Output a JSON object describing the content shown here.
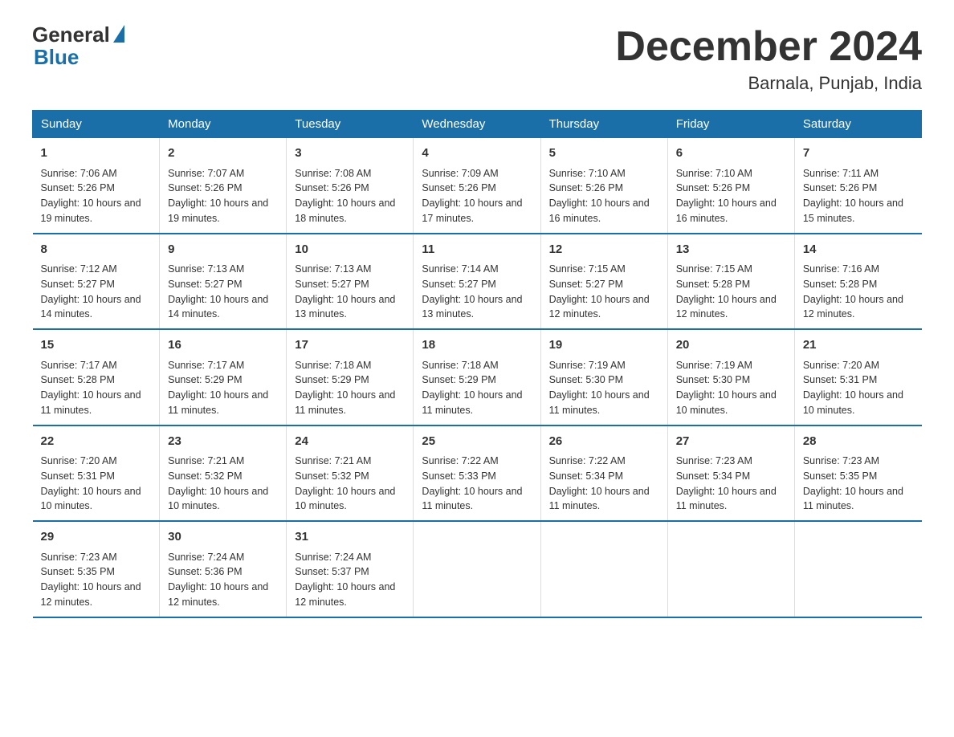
{
  "header": {
    "logo_general": "General",
    "logo_blue": "Blue",
    "month_title": "December 2024",
    "location": "Barnala, Punjab, India"
  },
  "days_of_week": [
    "Sunday",
    "Monday",
    "Tuesday",
    "Wednesday",
    "Thursday",
    "Friday",
    "Saturday"
  ],
  "weeks": [
    [
      {
        "day": "1",
        "sunrise": "Sunrise: 7:06 AM",
        "sunset": "Sunset: 5:26 PM",
        "daylight": "Daylight: 10 hours and 19 minutes."
      },
      {
        "day": "2",
        "sunrise": "Sunrise: 7:07 AM",
        "sunset": "Sunset: 5:26 PM",
        "daylight": "Daylight: 10 hours and 19 minutes."
      },
      {
        "day": "3",
        "sunrise": "Sunrise: 7:08 AM",
        "sunset": "Sunset: 5:26 PM",
        "daylight": "Daylight: 10 hours and 18 minutes."
      },
      {
        "day": "4",
        "sunrise": "Sunrise: 7:09 AM",
        "sunset": "Sunset: 5:26 PM",
        "daylight": "Daylight: 10 hours and 17 minutes."
      },
      {
        "day": "5",
        "sunrise": "Sunrise: 7:10 AM",
        "sunset": "Sunset: 5:26 PM",
        "daylight": "Daylight: 10 hours and 16 minutes."
      },
      {
        "day": "6",
        "sunrise": "Sunrise: 7:10 AM",
        "sunset": "Sunset: 5:26 PM",
        "daylight": "Daylight: 10 hours and 16 minutes."
      },
      {
        "day": "7",
        "sunrise": "Sunrise: 7:11 AM",
        "sunset": "Sunset: 5:26 PM",
        "daylight": "Daylight: 10 hours and 15 minutes."
      }
    ],
    [
      {
        "day": "8",
        "sunrise": "Sunrise: 7:12 AM",
        "sunset": "Sunset: 5:27 PM",
        "daylight": "Daylight: 10 hours and 14 minutes."
      },
      {
        "day": "9",
        "sunrise": "Sunrise: 7:13 AM",
        "sunset": "Sunset: 5:27 PM",
        "daylight": "Daylight: 10 hours and 14 minutes."
      },
      {
        "day": "10",
        "sunrise": "Sunrise: 7:13 AM",
        "sunset": "Sunset: 5:27 PM",
        "daylight": "Daylight: 10 hours and 13 minutes."
      },
      {
        "day": "11",
        "sunrise": "Sunrise: 7:14 AM",
        "sunset": "Sunset: 5:27 PM",
        "daylight": "Daylight: 10 hours and 13 minutes."
      },
      {
        "day": "12",
        "sunrise": "Sunrise: 7:15 AM",
        "sunset": "Sunset: 5:27 PM",
        "daylight": "Daylight: 10 hours and 12 minutes."
      },
      {
        "day": "13",
        "sunrise": "Sunrise: 7:15 AM",
        "sunset": "Sunset: 5:28 PM",
        "daylight": "Daylight: 10 hours and 12 minutes."
      },
      {
        "day": "14",
        "sunrise": "Sunrise: 7:16 AM",
        "sunset": "Sunset: 5:28 PM",
        "daylight": "Daylight: 10 hours and 12 minutes."
      }
    ],
    [
      {
        "day": "15",
        "sunrise": "Sunrise: 7:17 AM",
        "sunset": "Sunset: 5:28 PM",
        "daylight": "Daylight: 10 hours and 11 minutes."
      },
      {
        "day": "16",
        "sunrise": "Sunrise: 7:17 AM",
        "sunset": "Sunset: 5:29 PM",
        "daylight": "Daylight: 10 hours and 11 minutes."
      },
      {
        "day": "17",
        "sunrise": "Sunrise: 7:18 AM",
        "sunset": "Sunset: 5:29 PM",
        "daylight": "Daylight: 10 hours and 11 minutes."
      },
      {
        "day": "18",
        "sunrise": "Sunrise: 7:18 AM",
        "sunset": "Sunset: 5:29 PM",
        "daylight": "Daylight: 10 hours and 11 minutes."
      },
      {
        "day": "19",
        "sunrise": "Sunrise: 7:19 AM",
        "sunset": "Sunset: 5:30 PM",
        "daylight": "Daylight: 10 hours and 11 minutes."
      },
      {
        "day": "20",
        "sunrise": "Sunrise: 7:19 AM",
        "sunset": "Sunset: 5:30 PM",
        "daylight": "Daylight: 10 hours and 10 minutes."
      },
      {
        "day": "21",
        "sunrise": "Sunrise: 7:20 AM",
        "sunset": "Sunset: 5:31 PM",
        "daylight": "Daylight: 10 hours and 10 minutes."
      }
    ],
    [
      {
        "day": "22",
        "sunrise": "Sunrise: 7:20 AM",
        "sunset": "Sunset: 5:31 PM",
        "daylight": "Daylight: 10 hours and 10 minutes."
      },
      {
        "day": "23",
        "sunrise": "Sunrise: 7:21 AM",
        "sunset": "Sunset: 5:32 PM",
        "daylight": "Daylight: 10 hours and 10 minutes."
      },
      {
        "day": "24",
        "sunrise": "Sunrise: 7:21 AM",
        "sunset": "Sunset: 5:32 PM",
        "daylight": "Daylight: 10 hours and 10 minutes."
      },
      {
        "day": "25",
        "sunrise": "Sunrise: 7:22 AM",
        "sunset": "Sunset: 5:33 PM",
        "daylight": "Daylight: 10 hours and 11 minutes."
      },
      {
        "day": "26",
        "sunrise": "Sunrise: 7:22 AM",
        "sunset": "Sunset: 5:34 PM",
        "daylight": "Daylight: 10 hours and 11 minutes."
      },
      {
        "day": "27",
        "sunrise": "Sunrise: 7:23 AM",
        "sunset": "Sunset: 5:34 PM",
        "daylight": "Daylight: 10 hours and 11 minutes."
      },
      {
        "day": "28",
        "sunrise": "Sunrise: 7:23 AM",
        "sunset": "Sunset: 5:35 PM",
        "daylight": "Daylight: 10 hours and 11 minutes."
      }
    ],
    [
      {
        "day": "29",
        "sunrise": "Sunrise: 7:23 AM",
        "sunset": "Sunset: 5:35 PM",
        "daylight": "Daylight: 10 hours and 12 minutes."
      },
      {
        "day": "30",
        "sunrise": "Sunrise: 7:24 AM",
        "sunset": "Sunset: 5:36 PM",
        "daylight": "Daylight: 10 hours and 12 minutes."
      },
      {
        "day": "31",
        "sunrise": "Sunrise: 7:24 AM",
        "sunset": "Sunset: 5:37 PM",
        "daylight": "Daylight: 10 hours and 12 minutes."
      },
      {
        "day": "",
        "sunrise": "",
        "sunset": "",
        "daylight": ""
      },
      {
        "day": "",
        "sunrise": "",
        "sunset": "",
        "daylight": ""
      },
      {
        "day": "",
        "sunrise": "",
        "sunset": "",
        "daylight": ""
      },
      {
        "day": "",
        "sunrise": "",
        "sunset": "",
        "daylight": ""
      }
    ]
  ]
}
